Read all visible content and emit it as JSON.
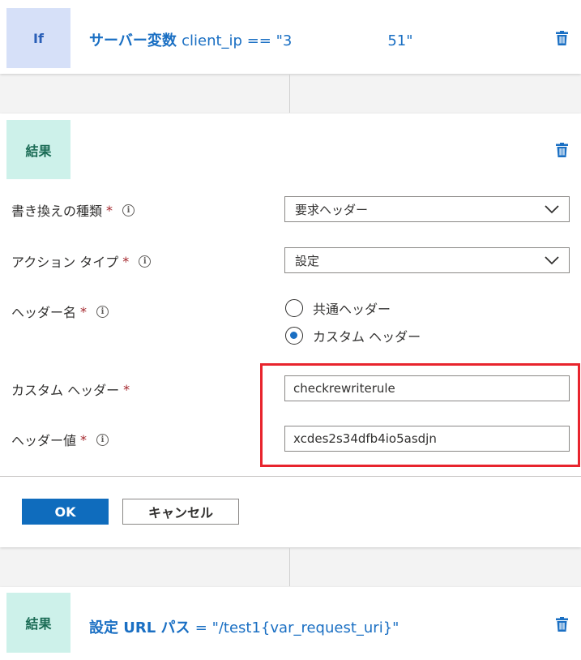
{
  "if_row": {
    "badge": "If",
    "title_prefix": "サーバー変数",
    "title_expr": "client_ip == \"3",
    "title_suffix": "51\""
  },
  "result_card": {
    "badge": "結果",
    "fields": {
      "rewrite_type": {
        "label": "書き換えの種類",
        "required": "*",
        "value": "要求ヘッダー"
      },
      "action_type": {
        "label": "アクション タイプ",
        "required": "*",
        "value": "設定"
      },
      "header_name": {
        "label": "ヘッダー名",
        "required": "*",
        "options": [
          "共通ヘッダー",
          "カスタム ヘッダー"
        ],
        "selected": "カスタム ヘッダー"
      },
      "custom_header": {
        "label": "カスタム ヘッダー",
        "required": "*",
        "value": "checkrewriterule"
      },
      "header_value": {
        "label": "ヘッダー値",
        "required": "*",
        "value": "xcdes2s34dfb4io5asdjn"
      }
    },
    "buttons": {
      "ok": "OK",
      "cancel": "キャンセル"
    }
  },
  "bottom_row": {
    "badge": "結果",
    "title_prefix": "設定 URL パス",
    "title_expr": "= \"/test1{var_request_uri}\""
  },
  "colors": {
    "accent": "#1a6fc3",
    "highlight": "#e8242d",
    "if_badge_bg": "#d6e0f8",
    "result_badge_bg": "#cdf1ea"
  },
  "icons": {
    "trash": "trash-icon",
    "info": "info-icon",
    "chevron": "chevron-down-icon"
  }
}
